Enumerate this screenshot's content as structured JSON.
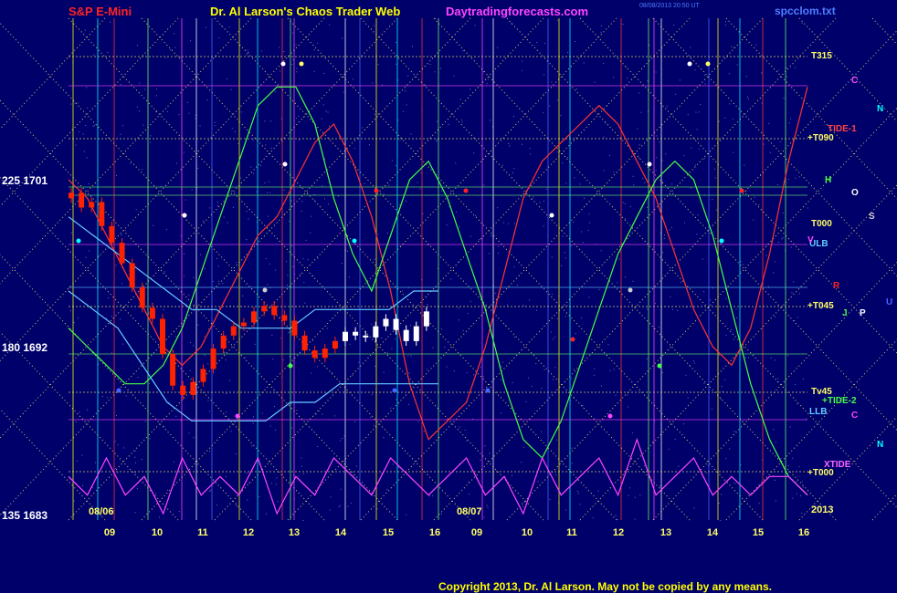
{
  "header": {
    "symbol": "S&P E-Mini",
    "title": "Dr. Al Larson's Chaos Trader Web",
    "site": "Daytradingforecasts.com",
    "timestamp_line1": "08/08/2013 20:50 UT",
    "file": "spcclom.txt"
  },
  "y_labels": [
    {
      "text": "225  1701"
    },
    {
      "text": "180  1692"
    },
    {
      "text": "135  1683"
    }
  ],
  "copyright": "Copyright 2013, Dr. Al Larson. May not be copied by any means.",
  "right_labels": [
    {
      "text": "T315",
      "color": "#ffff66"
    },
    {
      "text": "TIDE-1",
      "color": "#ff4444"
    },
    {
      "text": "+T090",
      "color": "#ffff66"
    },
    {
      "text": "T000",
      "color": "#ffff66"
    },
    {
      "text": "ULB",
      "color": "#66ccff"
    },
    {
      "text": "+T045",
      "color": "#ffff66"
    },
    {
      "text": "Tv45",
      "color": "#ffff66"
    },
    {
      "text": "+TIDE-2",
      "color": "#44ff44"
    },
    {
      "text": "LLB",
      "color": "#66ccff"
    },
    {
      "text": "XTIDE",
      "color": "#ff66ff"
    },
    {
      "text": "+T000",
      "color": "#ffff66"
    },
    {
      "text": "2013",
      "color": "#ffff66"
    }
  ],
  "glyphs": [
    {
      "text": "C",
      "color": "#ff44ff"
    },
    {
      "text": "N",
      "color": "#00ffff"
    },
    {
      "text": "H",
      "color": "#44ff44"
    },
    {
      "text": "O",
      "color": "#ffffff"
    },
    {
      "text": "S",
      "color": "#cccccc"
    },
    {
      "text": "V",
      "color": "#ff44ff"
    },
    {
      "text": "R",
      "color": "#ff2222"
    },
    {
      "text": "U",
      "color": "#4466ff"
    },
    {
      "text": "J",
      "color": "#44ff44"
    },
    {
      "text": "P",
      "color": "#ffffff"
    },
    {
      "text": "C",
      "color": "#ff44ff"
    },
    {
      "text": "N",
      "color": "#00ffff"
    }
  ],
  "chart_data": {
    "type": "line",
    "title": "S&P E-Mini",
    "y_left_labels": [
      "225  1701",
      "180  1692",
      "135  1683"
    ],
    "y_range_price": [
      1683,
      1701
    ],
    "date_labels": [
      "08/06",
      "08/07"
    ],
    "x_hours": [
      "09",
      "10",
      "11",
      "12",
      "13",
      "14",
      "15",
      "16",
      "09",
      "10",
      "11",
      "12",
      "13",
      "14",
      "15",
      "16"
    ],
    "series": [
      {
        "name": "TIDE-1",
        "color": "#ff3333",
        "values": [
          1701,
          1700,
          1698,
          1696,
          1694,
          1692,
          1691,
          1692,
          1694,
          1696,
          1698,
          1699,
          1701,
          1703,
          1704,
          1702,
          1699,
          1695,
          1690,
          1687,
          1688,
          1689,
          1692,
          1696,
          1700,
          1702,
          1703,
          1704,
          1705,
          1704,
          1702,
          1700,
          1697,
          1694,
          1692,
          1691,
          1693,
          1697,
          1702,
          1706
        ]
      },
      {
        "name": "TIDE-2",
        "color": "#44ff44",
        "values": [
          1693,
          1692,
          1691,
          1690,
          1690,
          1691,
          1693,
          1696,
          1699,
          1702,
          1705,
          1706,
          1706,
          1704,
          1700,
          1697,
          1695,
          1698,
          1701,
          1702,
          1700,
          1697,
          1694,
          1690,
          1687,
          1686,
          1688,
          1691,
          1694,
          1697,
          1699,
          1701,
          1702,
          1701,
          1698,
          1694,
          1690,
          1687,
          1685,
          1684
        ]
      },
      {
        "name": "XTIDE",
        "color": "#ff44ff",
        "values": [
          1685,
          1684,
          1686,
          1684,
          1685,
          1683,
          1686,
          1684,
          1685,
          1684,
          1686,
          1683,
          1685,
          1684,
          1686,
          1685,
          1684,
          1686,
          1685,
          1684,
          1685,
          1686,
          1684,
          1685,
          1683,
          1686,
          1684,
          1685,
          1686,
          1684,
          1687,
          1684,
          1685,
          1686,
          1684,
          1685,
          1684,
          1685,
          1685,
          1684
        ]
      },
      {
        "name": "ULB",
        "color": "#66ccff",
        "values": [
          1699,
          1698,
          1697,
          1696,
          1695,
          1694,
          1694,
          1693,
          1693,
          1693,
          1694,
          1694,
          1694,
          1694,
          1695,
          1695
        ]
      },
      {
        "name": "LLB",
        "color": "#66ccff",
        "values": [
          1695,
          1694,
          1693,
          1691,
          1689,
          1688,
          1688,
          1688,
          1688,
          1689,
          1689,
          1690,
          1690,
          1690,
          1690,
          1690
        ]
      },
      {
        "name": "price",
        "color": "#ff2200",
        "values": [
          1700,
          1700.3,
          1699.5,
          1699.8,
          1698.5,
          1697.6,
          1696.5,
          1695.2,
          1694.1,
          1693.5,
          1691.6,
          1689.9,
          1689.4,
          1690.1,
          1690.8,
          1691.9,
          1692.6,
          1693.1,
          1693.3,
          1693.9,
          1694.2,
          1693.7,
          1693.4,
          1692.6,
          1691.8,
          1691.4,
          1691.9,
          1692.3,
          1692.8,
          1692.6,
          1692.5,
          1693.1,
          1693.5,
          1692.9,
          1692.3,
          1693.1,
          1693.9
        ]
      }
    ]
  }
}
